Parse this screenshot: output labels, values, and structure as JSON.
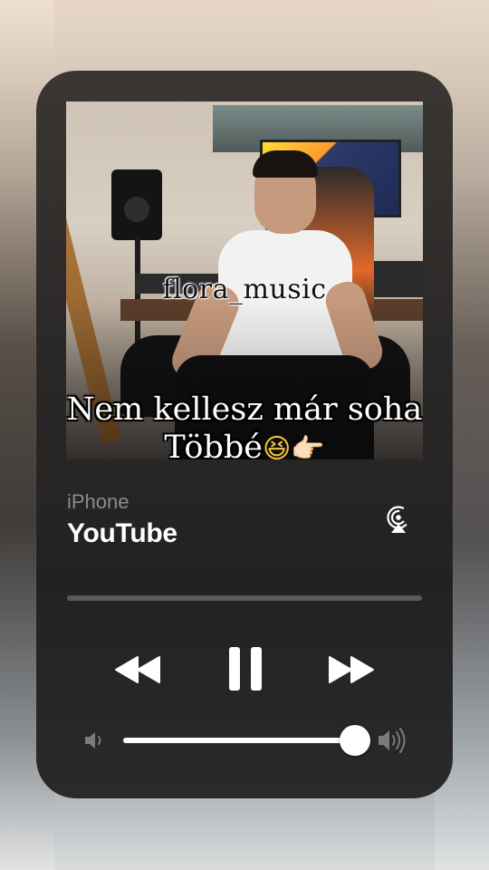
{
  "now_playing": {
    "artwork": {
      "handle_text": "flora_music",
      "caption_line1": "Nem kellesz már soha",
      "caption_line2": "Többé",
      "caption_emojis": [
        "😆",
        "👉🏻"
      ]
    },
    "source_label": "iPhone",
    "app_name": "YouTube",
    "airplay_icon": "airplay-audio-icon",
    "progress": 0.0,
    "controls": {
      "rewind_icon": "rewind-icon",
      "pause_icon": "pause-icon",
      "forward_icon": "fast-forward-icon"
    },
    "volume": {
      "level": 1.0,
      "low_icon": "speaker-low-icon",
      "high_icon": "speaker-high-icon"
    }
  },
  "colors": {
    "card_background": "#2a2827",
    "text_primary": "#ffffff",
    "text_secondary": "#8e8b88",
    "track": "#5b5857"
  }
}
